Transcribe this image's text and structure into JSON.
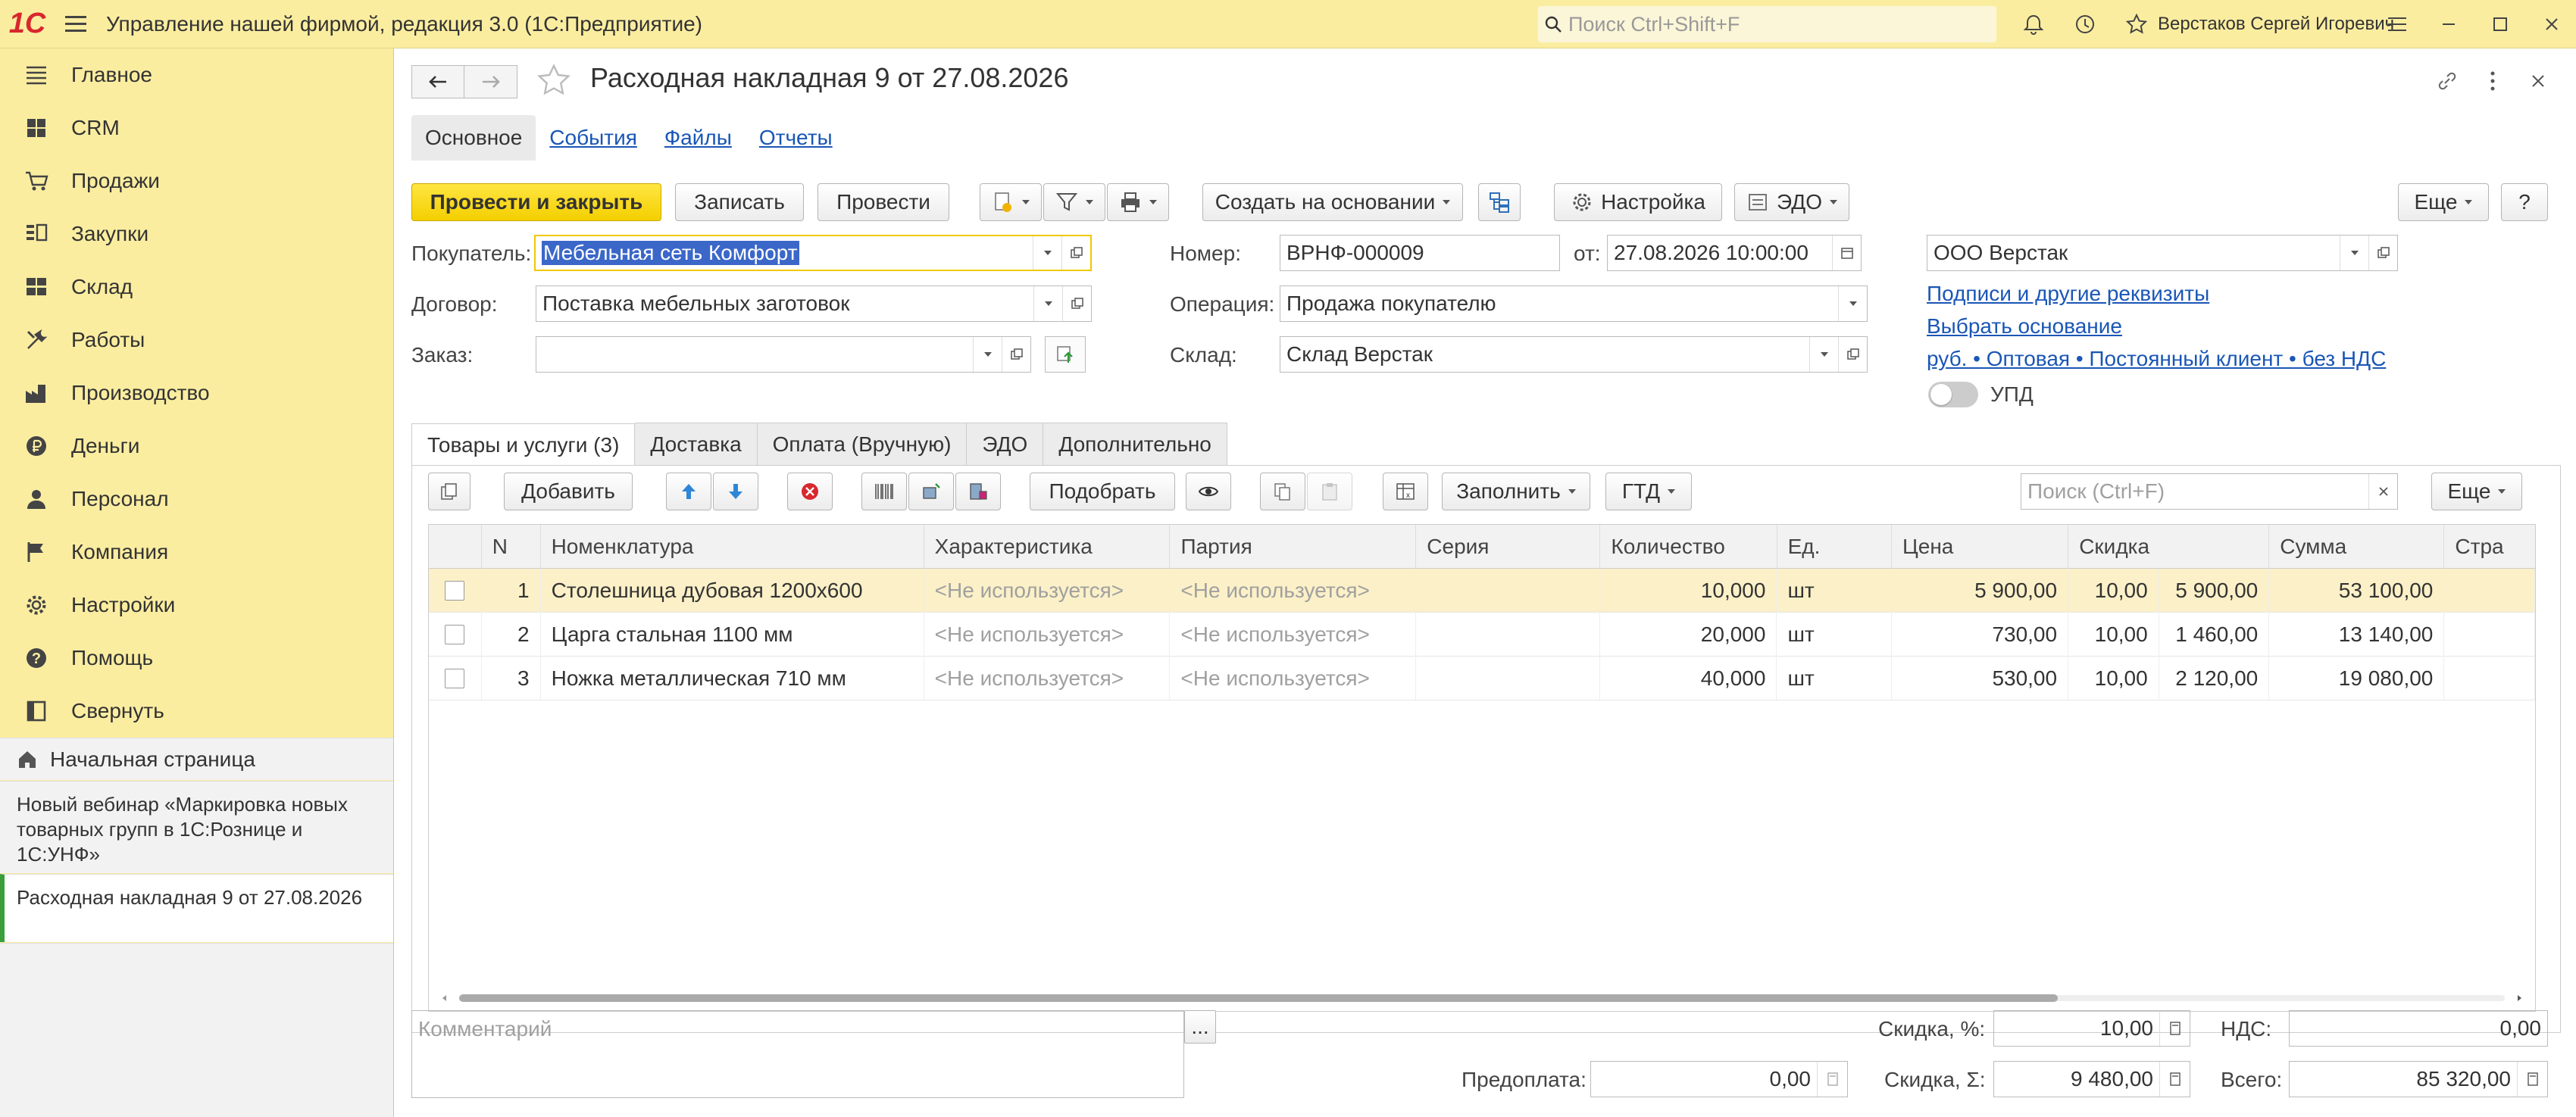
{
  "app": {
    "title": "Управление нашей фирмой, редакция 3.0  (1С:Предприятие)",
    "logo_text": "1С",
    "search_placeholder": "Поиск Ctrl+Shift+F",
    "user": "Верстаков Сергей Игоревич"
  },
  "sidebar": {
    "items": [
      {
        "label": "Главное",
        "icon": "menu-lines-icon"
      },
      {
        "label": "CRM",
        "icon": "crm-icon"
      },
      {
        "label": "Продажи",
        "icon": "cart-icon"
      },
      {
        "label": "Закупки",
        "icon": "purchases-icon"
      },
      {
        "label": "Склад",
        "icon": "warehouse-icon"
      },
      {
        "label": "Работы",
        "icon": "tools-icon"
      },
      {
        "label": "Производство",
        "icon": "factory-icon"
      },
      {
        "label": "Деньги",
        "icon": "ruble-icon"
      },
      {
        "label": "Персонал",
        "icon": "person-icon"
      },
      {
        "label": "Компания",
        "icon": "flag-icon"
      },
      {
        "label": "Настройки",
        "icon": "gear-icon"
      },
      {
        "label": "Помощь",
        "icon": "help-icon"
      },
      {
        "label": "Свернуть",
        "icon": "collapse-icon"
      }
    ],
    "home": "Начальная страница",
    "open_docs": [
      "Новый вебинар «Маркировка новых товарных групп в 1С:Рознице и 1С:УНФ»",
      "Расходная накладная 9 от 27.08.2026"
    ]
  },
  "doc": {
    "title": "Расходная накладная 9 от 27.08.2026",
    "tabs": [
      "Основное",
      "События",
      "Файлы",
      "Отчеты"
    ],
    "toolbar": {
      "post_close": "Провести и закрыть",
      "save": "Записать",
      "post": "Провести",
      "create_based": "Создать на основании",
      "settings": "Настройка",
      "edo": "ЭДО",
      "more": "Еще",
      "help": "?"
    },
    "fields": {
      "buyer_label": "Покупатель:",
      "buyer": "Мебельная сеть Комфорт",
      "contract_label": "Договор:",
      "contract": "Поставка мебельных заготовок",
      "order_label": "Заказ:",
      "order": "",
      "number_label": "Номер:",
      "number": "ВРНФ-000009",
      "date_label": "от:",
      "date": "27.08.2026 10:00:00",
      "operation_label": "Операция:",
      "operation": "Продажа покупателю",
      "warehouse_label": "Склад:",
      "warehouse": "Склад Верстак",
      "company": "ООО Верстак"
    },
    "links": {
      "signatures": "Подписи и другие реквизиты",
      "choose_basis": "Выбрать основание",
      "price_info": "руб. • Оптовая • Постоянный клиент • без НДС"
    },
    "upd_label": "УПД",
    "upd_on": false
  },
  "products": {
    "tabs": [
      "Товары и услуги (3)",
      "Доставка",
      "Оплата (Вручную)",
      "ЭДО",
      "Дополнительно"
    ],
    "toolbar": {
      "add": "Добавить",
      "pick": "Подобрать",
      "fill": "Заполнить",
      "gtd": "ГТД",
      "search_placeholder": "Поиск (Ctrl+F)",
      "more": "Еще"
    },
    "columns": [
      "N",
      "Номенклатура",
      "Характеристика",
      "Партия",
      "Серия",
      "Количество",
      "Ед.",
      "Цена",
      "Скидка",
      "",
      "Сумма",
      "Стра"
    ],
    "rows": [
      {
        "n": "1",
        "name": "Столешница дубовая 1200х600",
        "char": "<Не используется>",
        "batch": "<Не используется>",
        "series": "",
        "qty": "10,000",
        "unit": "шт",
        "price": "5 900,00",
        "disc_pct": "10,00",
        "disc_sum": "5 900,00",
        "sum": "53 100,00"
      },
      {
        "n": "2",
        "name": "Царга стальная 1100 мм",
        "char": "<Не используется>",
        "batch": "<Не используется>",
        "series": "",
        "qty": "20,000",
        "unit": "шт",
        "price": "730,00",
        "disc_pct": "10,00",
        "disc_sum": "1 460,00",
        "sum": "13 140,00"
      },
      {
        "n": "3",
        "name": "Ножка металлическая 710 мм",
        "char": "<Не используется>",
        "batch": "<Не используется>",
        "series": "",
        "qty": "40,000",
        "unit": "шт",
        "price": "530,00",
        "disc_pct": "10,00",
        "disc_sum": "2 120,00",
        "sum": "19 080,00"
      }
    ]
  },
  "footer": {
    "comment_placeholder": "Комментарий",
    "comment_btn": "...",
    "prepay_label": "Предоплата:",
    "prepay": "0,00",
    "discount_pct_label": "Скидка, %:",
    "discount_pct": "10,00",
    "discount_sum_label": "Скидка, Σ:",
    "discount_sum": "9 480,00",
    "vat_label": "НДС:",
    "vat": "0,00",
    "total_label": "Всего:",
    "total": "85 320,00"
  }
}
